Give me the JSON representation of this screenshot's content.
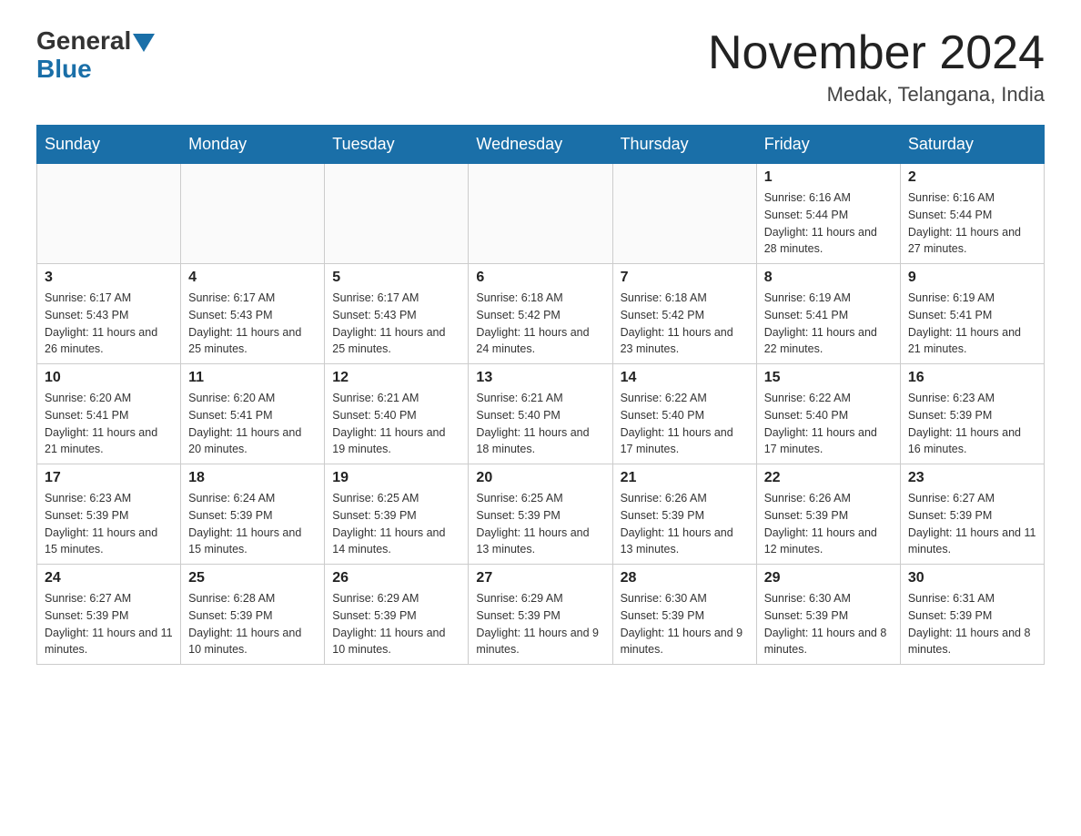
{
  "header": {
    "logo_general": "General",
    "logo_blue": "Blue",
    "month_title": "November 2024",
    "location": "Medak, Telangana, India"
  },
  "days_of_week": [
    "Sunday",
    "Monday",
    "Tuesday",
    "Wednesday",
    "Thursday",
    "Friday",
    "Saturday"
  ],
  "weeks": [
    [
      {
        "day": "",
        "info": ""
      },
      {
        "day": "",
        "info": ""
      },
      {
        "day": "",
        "info": ""
      },
      {
        "day": "",
        "info": ""
      },
      {
        "day": "",
        "info": ""
      },
      {
        "day": "1",
        "info": "Sunrise: 6:16 AM\nSunset: 5:44 PM\nDaylight: 11 hours and 28 minutes."
      },
      {
        "day": "2",
        "info": "Sunrise: 6:16 AM\nSunset: 5:44 PM\nDaylight: 11 hours and 27 minutes."
      }
    ],
    [
      {
        "day": "3",
        "info": "Sunrise: 6:17 AM\nSunset: 5:43 PM\nDaylight: 11 hours and 26 minutes."
      },
      {
        "day": "4",
        "info": "Sunrise: 6:17 AM\nSunset: 5:43 PM\nDaylight: 11 hours and 25 minutes."
      },
      {
        "day": "5",
        "info": "Sunrise: 6:17 AM\nSunset: 5:43 PM\nDaylight: 11 hours and 25 minutes."
      },
      {
        "day": "6",
        "info": "Sunrise: 6:18 AM\nSunset: 5:42 PM\nDaylight: 11 hours and 24 minutes."
      },
      {
        "day": "7",
        "info": "Sunrise: 6:18 AM\nSunset: 5:42 PM\nDaylight: 11 hours and 23 minutes."
      },
      {
        "day": "8",
        "info": "Sunrise: 6:19 AM\nSunset: 5:41 PM\nDaylight: 11 hours and 22 minutes."
      },
      {
        "day": "9",
        "info": "Sunrise: 6:19 AM\nSunset: 5:41 PM\nDaylight: 11 hours and 21 minutes."
      }
    ],
    [
      {
        "day": "10",
        "info": "Sunrise: 6:20 AM\nSunset: 5:41 PM\nDaylight: 11 hours and 21 minutes."
      },
      {
        "day": "11",
        "info": "Sunrise: 6:20 AM\nSunset: 5:41 PM\nDaylight: 11 hours and 20 minutes."
      },
      {
        "day": "12",
        "info": "Sunrise: 6:21 AM\nSunset: 5:40 PM\nDaylight: 11 hours and 19 minutes."
      },
      {
        "day": "13",
        "info": "Sunrise: 6:21 AM\nSunset: 5:40 PM\nDaylight: 11 hours and 18 minutes."
      },
      {
        "day": "14",
        "info": "Sunrise: 6:22 AM\nSunset: 5:40 PM\nDaylight: 11 hours and 17 minutes."
      },
      {
        "day": "15",
        "info": "Sunrise: 6:22 AM\nSunset: 5:40 PM\nDaylight: 11 hours and 17 minutes."
      },
      {
        "day": "16",
        "info": "Sunrise: 6:23 AM\nSunset: 5:39 PM\nDaylight: 11 hours and 16 minutes."
      }
    ],
    [
      {
        "day": "17",
        "info": "Sunrise: 6:23 AM\nSunset: 5:39 PM\nDaylight: 11 hours and 15 minutes."
      },
      {
        "day": "18",
        "info": "Sunrise: 6:24 AM\nSunset: 5:39 PM\nDaylight: 11 hours and 15 minutes."
      },
      {
        "day": "19",
        "info": "Sunrise: 6:25 AM\nSunset: 5:39 PM\nDaylight: 11 hours and 14 minutes."
      },
      {
        "day": "20",
        "info": "Sunrise: 6:25 AM\nSunset: 5:39 PM\nDaylight: 11 hours and 13 minutes."
      },
      {
        "day": "21",
        "info": "Sunrise: 6:26 AM\nSunset: 5:39 PM\nDaylight: 11 hours and 13 minutes."
      },
      {
        "day": "22",
        "info": "Sunrise: 6:26 AM\nSunset: 5:39 PM\nDaylight: 11 hours and 12 minutes."
      },
      {
        "day": "23",
        "info": "Sunrise: 6:27 AM\nSunset: 5:39 PM\nDaylight: 11 hours and 11 minutes."
      }
    ],
    [
      {
        "day": "24",
        "info": "Sunrise: 6:27 AM\nSunset: 5:39 PM\nDaylight: 11 hours and 11 minutes."
      },
      {
        "day": "25",
        "info": "Sunrise: 6:28 AM\nSunset: 5:39 PM\nDaylight: 11 hours and 10 minutes."
      },
      {
        "day": "26",
        "info": "Sunrise: 6:29 AM\nSunset: 5:39 PM\nDaylight: 11 hours and 10 minutes."
      },
      {
        "day": "27",
        "info": "Sunrise: 6:29 AM\nSunset: 5:39 PM\nDaylight: 11 hours and 9 minutes."
      },
      {
        "day": "28",
        "info": "Sunrise: 6:30 AM\nSunset: 5:39 PM\nDaylight: 11 hours and 9 minutes."
      },
      {
        "day": "29",
        "info": "Sunrise: 6:30 AM\nSunset: 5:39 PM\nDaylight: 11 hours and 8 minutes."
      },
      {
        "day": "30",
        "info": "Sunrise: 6:31 AM\nSunset: 5:39 PM\nDaylight: 11 hours and 8 minutes."
      }
    ]
  ]
}
